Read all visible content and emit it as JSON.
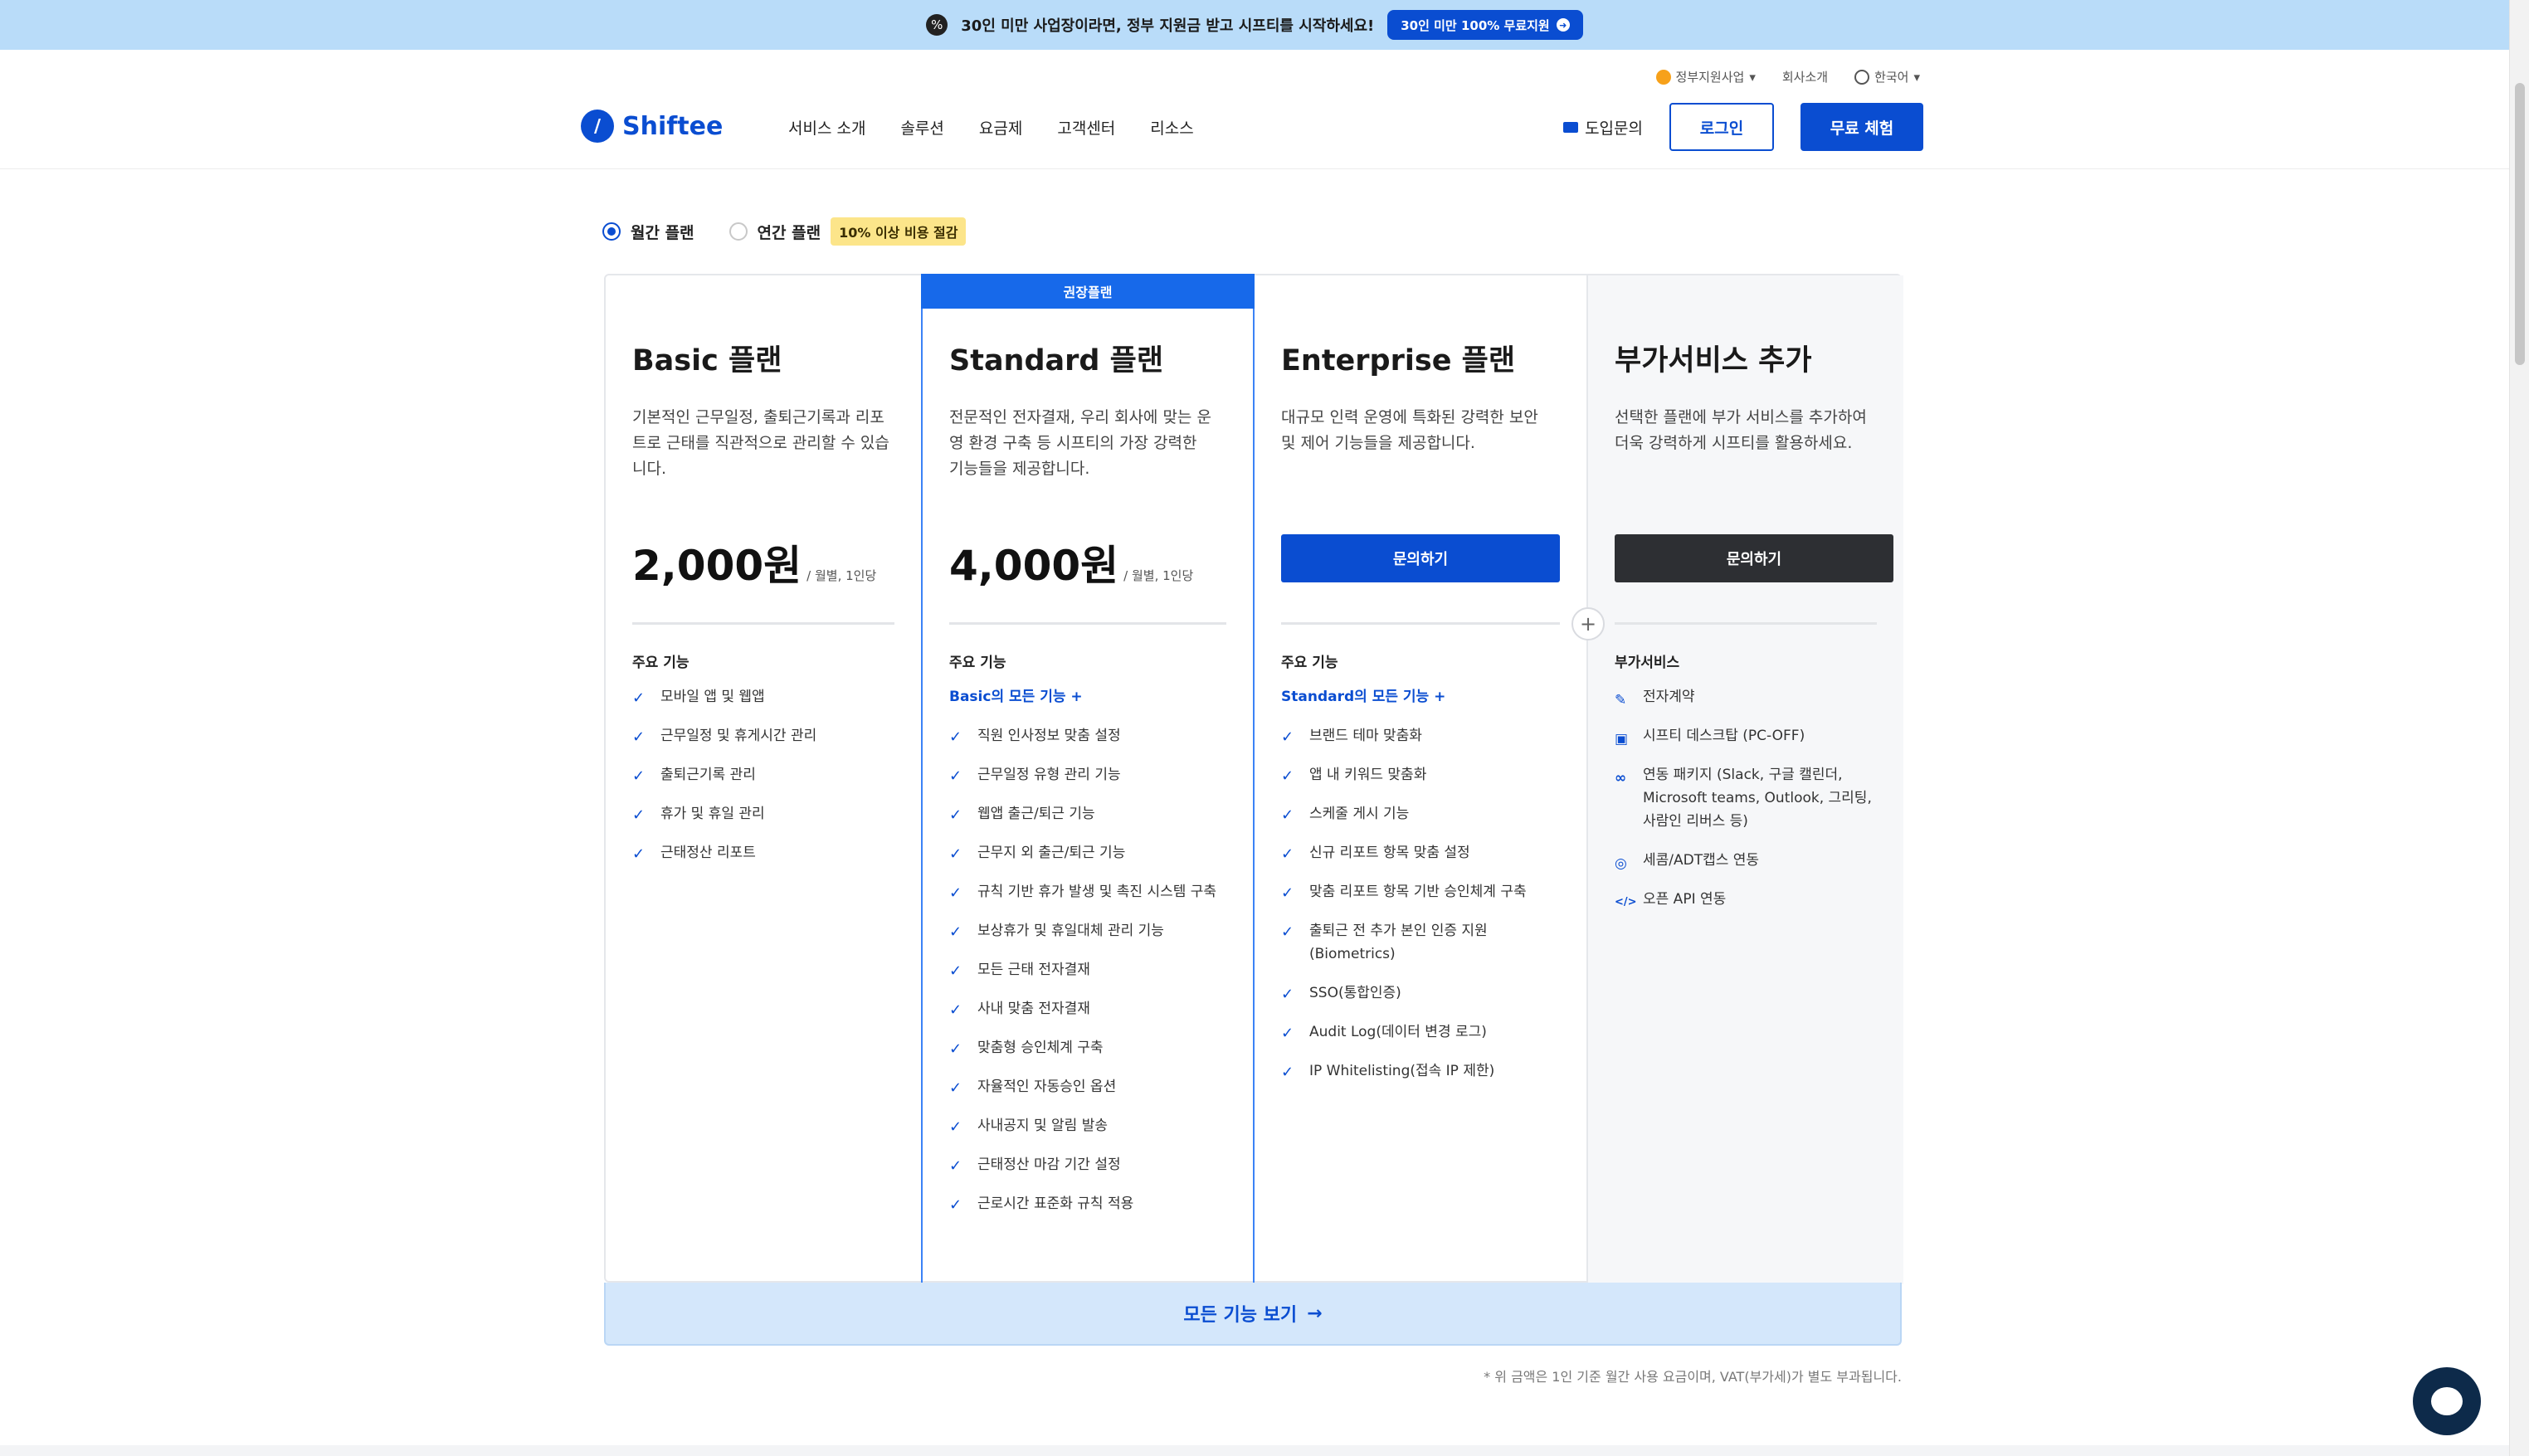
{
  "banner": {
    "text": "30인 미만 사업장이라면, 정부 지원금 받고 시프티를 시작하세요!",
    "button": "30인 미만 100% 무료지원",
    "icon": "percent-badge-icon"
  },
  "header": {
    "logo": "Shiftee",
    "util_links": [
      "정부지원사업",
      "회사소개",
      "한국어"
    ],
    "nav": [
      "서비스 소개",
      "솔루션",
      "요금제",
      "고객센터",
      "리소스"
    ],
    "inquiry": "도입문의",
    "login": "로그인",
    "trial": "무료 체험"
  },
  "toggle": {
    "monthly": "월간 플랜",
    "yearly": "연간 플랜",
    "badge": "10% 이상 비용 절감",
    "selected": "monthly"
  },
  "plans": {
    "recommended_tag": "권장플랜",
    "basic": {
      "name": "Basic 플랜",
      "desc": "기본적인 근무일정, 출퇴근기록과 리포트로 근태를 직관적으로 관리할 수 있습니다.",
      "price": "2,000원",
      "unit": "/ 월별, 1인당",
      "feature_title": "주요 기능",
      "features": [
        "모바일 앱 및 웹앱",
        "근무일정 및 휴게시간 관리",
        "출퇴근기록 관리",
        "휴가 및 휴일 관리",
        "근태정산 리포트"
      ]
    },
    "standard": {
      "name": "Standard 플랜",
      "desc": "전문적인 전자결재, 우리 회사에 맞는 운영 환경 구축 등 시프티의 가장 강력한 기능들을 제공합니다.",
      "price": "4,000원",
      "unit": "/ 월별, 1인당",
      "feature_title": "주요 기능",
      "includes": "Basic의 모든 기능 +",
      "features": [
        "직원 인사정보 맞춤 설정",
        "근무일정 유형 관리 기능",
        "웹앱 출근/퇴근 기능",
        "근무지 외 출근/퇴근 기능",
        "규칙 기반 휴가 발생 및 촉진 시스템 구축",
        "보상휴가 및 휴일대체 관리 기능",
        "모든 근태 전자결재",
        "사내 맞춤 전자결재",
        "맞춤형 승인체계 구축",
        "자율적인 자동승인 옵션",
        "사내공지 및 알림 발송",
        "근태정산 마감 기간 설정",
        "근로시간 표준화 규칙 적용"
      ]
    },
    "enterprise": {
      "name": "Enterprise 플랜",
      "desc": "대규모 인력 운영에 특화된 강력한 보안 및 제어 기능들을 제공합니다.",
      "cta": "문의하기",
      "feature_title": "주요 기능",
      "includes": "Standard의 모든 기능 +",
      "features": [
        "브랜드 테마 맞춤화",
        "앱 내 키워드 맞춤화",
        "스케줄 게시 기능",
        "신규 리포트 항목 맞춤 설정",
        "맞춤 리포트 항목 기반 승인체계 구축",
        "출퇴근 전 추가 본인 인증 지원 (Biometrics)",
        "SSO(통합인증)",
        "Audit Log(데이터 변경 로그)",
        "IP Whitelisting(접속 IP 제한)"
      ]
    },
    "addon": {
      "name": "부가서비스 추가",
      "desc": "선택한 플랜에 부가 서비스를 추가하여 더욱 강력하게 시프티를 활용하세요.",
      "cta": "문의하기",
      "feature_title": "부가서비스",
      "features": [
        {
          "label": "전자계약",
          "icon": "sign-document-icon"
        },
        {
          "label": "시프티 데스크탑 (PC-OFF)",
          "icon": "monitor-icon"
        },
        {
          "label": "연동 패키지 (Slack, 구글 캘린더, Microsoft teams, Outlook, 그리팅, 사람인 리버스 등)",
          "icon": "link-icon"
        },
        {
          "label": "세콤/ADT캡스 연동",
          "icon": "fingerprint-icon"
        },
        {
          "label": "오픈 API 연동",
          "icon": "code-icon"
        }
      ]
    }
  },
  "see_all": "모든 기능 보기",
  "footnote": "* 위 금액은 1인 기준 월간 사용 요금이며, VAT(부가세)가 별도 부과됩니다.",
  "colors": {
    "brand": "#0a4dd1",
    "recommended": "#1769ea",
    "banner": "#b9dcf9",
    "badge": "#fce58a"
  }
}
